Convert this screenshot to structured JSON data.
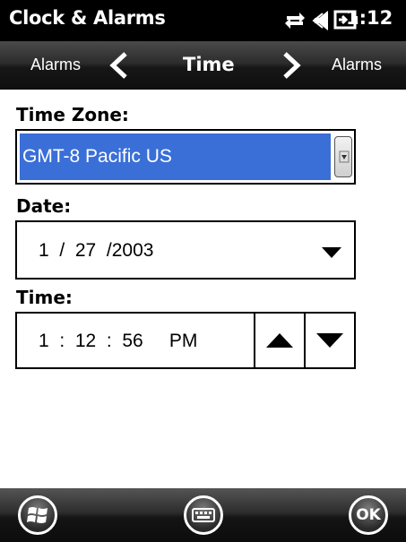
{
  "status_bar": {
    "title": "Clock & Alarms",
    "time": "1:12",
    "icons": [
      "data-sync-icon",
      "speaker-icon",
      "battery-charging-icon"
    ]
  },
  "nav": {
    "prev_label": "Alarms",
    "title": "Time",
    "next_label": "Alarms"
  },
  "time_zone": {
    "label": "Time Zone:",
    "value": "GMT-8 Pacific US"
  },
  "date": {
    "label": "Date:",
    "value": "1  /  27  /2003"
  },
  "time": {
    "label": "Time:",
    "value": "1  :  12  :  56     PM"
  },
  "bottom_bar": {
    "ok_label": "OK"
  },
  "colors": {
    "selection": "#3a6fd8",
    "bar": "#000000"
  }
}
